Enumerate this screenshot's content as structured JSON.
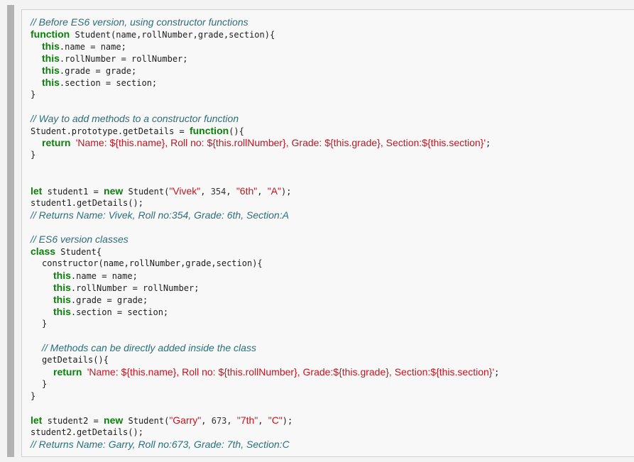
{
  "code": {
    "comments": {
      "before_es6": "// Before ES6 version, using constructor functions",
      "add_methods": "// Way to add methods to a constructor function",
      "returns1": "// Returns Name: Vivek, Roll no:354, Grade: 6th, Section:A",
      "es6_classes": "// ES6 version classes",
      "methods_inside": "// Methods can be directly added inside the class",
      "returns2": "// Returns Name: Garry, Roll no:673, Grade: 7th, Section:C"
    },
    "keywords": {
      "function": "function",
      "this": "this",
      "return": "return",
      "let": "let",
      "new": "new",
      "class": "class"
    },
    "text": {
      "fn_sig": " Student(name,rollNumber,grade,section){",
      "name_assign": ".name = name;",
      "roll_assign": ".rollNumber = rollNumber;",
      "grade_assign": ".grade = grade;",
      "section_assign": ".section = section;",
      "close_brace": "}",
      "proto_assign": "Student.prototype.getDetails = ",
      "fn_open": "(){",
      "semicolon": ";",
      "s1_decl": " student1 = ",
      "s2_decl": " student2 = ",
      "student_call": " Student(",
      "comma": ", ",
      "call_close": ");",
      "s1_call": "student1.getDetails();",
      "s2_call": "student2.getDetails();",
      "class_decl": " Student{",
      "constructor_sig": "constructor(name,rollNumber,grade,section){",
      "get_details": "getDetails(){"
    },
    "strings": {
      "template1": "'Name: ${this.name}, Roll no: ${this.rollNumber}, Grade: ${this.grade}, Section:${this.section}'",
      "template2": "'Name: ${this.name}, Roll no: ${this.rollNumber}, Grade:${this.grade}, Section:${this.section}'",
      "vivek": "\"Vivek\"",
      "sixth": "\"6th\"",
      "grade_a": "\"A\"",
      "garry": "\"Garry\"",
      "seventh": "\"7th\"",
      "grade_c": "\"C\""
    },
    "numbers": {
      "roll1": "354",
      "roll2": "673"
    }
  }
}
